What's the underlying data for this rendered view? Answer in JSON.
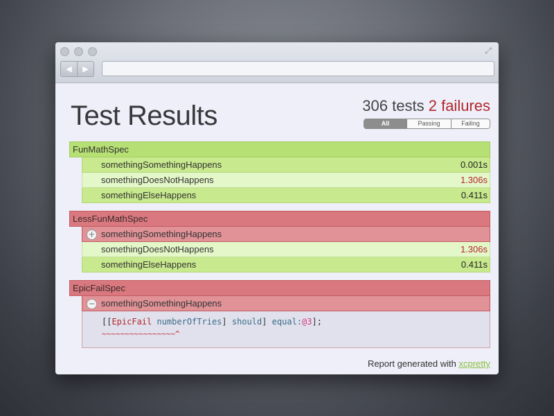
{
  "page": {
    "title": "Test Results",
    "tests_count": "306",
    "tests_label": "tests",
    "failures_count": "2",
    "failures_label": "failures"
  },
  "filters": {
    "all": "All",
    "passing": "Passing",
    "failing": "Failing",
    "selected": "All"
  },
  "suites": [
    {
      "name": "FunMathSpec",
      "status": "pass",
      "tests": [
        {
          "name": "somethingSomethingHappens",
          "time": "0.001s"
        },
        {
          "name": "somethingDoesNotHappens",
          "time": "1.306s"
        },
        {
          "name": "somethingElseHappens",
          "time": "0.411s"
        }
      ]
    },
    {
      "name": "LessFunMathSpec",
      "status": "fail",
      "tests": [
        {
          "name": "somethingSomethingHappens",
          "toggle": "+"
        },
        {
          "name": "somethingDoesNotHappens",
          "time": "1.306s"
        },
        {
          "name": "somethingElseHappens",
          "time": "0.411s"
        }
      ]
    },
    {
      "name": "EpicFailSpec",
      "status": "fail",
      "tests": [
        {
          "name": "somethingSomethingHappens",
          "toggle": "−"
        }
      ],
      "code": {
        "open": "[[",
        "class": "EpicFail",
        "sp1": " ",
        "method": "numberOfTries",
        "mid": "] ",
        "should": "should",
        "close": "] ",
        "equal": "equal:",
        "value": "@3",
        "end": "];",
        "caret": "~~~~~~~~~~~~~~~~^"
      }
    }
  ],
  "footer": {
    "text": "Report generated with",
    "link": "xcpretty"
  },
  "colors": {
    "pass": "#b6df74",
    "fail": "#d9797f",
    "failure_text": "#b3262d",
    "link": "#8bbf3e"
  },
  "icons": [
    "traffic-light-icon",
    "expand-icon",
    "back-arrow-icon",
    "forward-arrow-icon",
    "expand-plus-icon",
    "collapse-minus-icon"
  ]
}
